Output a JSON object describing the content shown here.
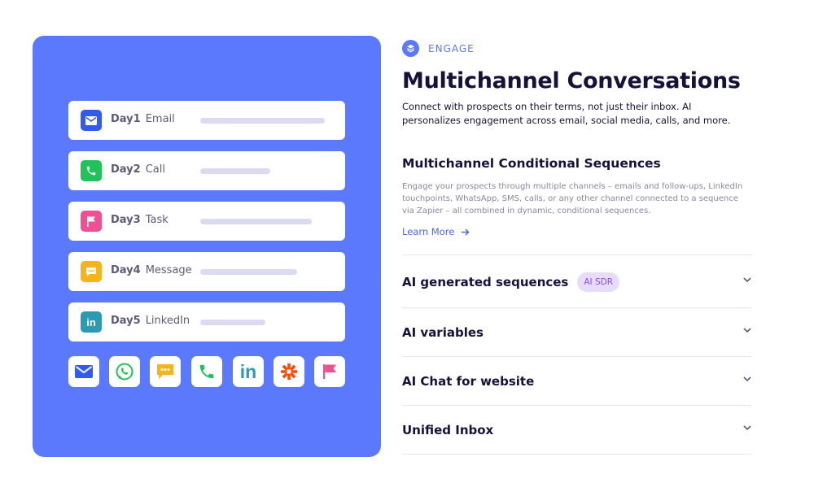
{
  "left": {
    "days": [
      {
        "day": "Day1",
        "channel": "Email",
        "icon": "email-icon",
        "color": "#2f5bf0",
        "bar_fraction": 0.9
      },
      {
        "day": "Day2",
        "channel": "Call",
        "icon": "phone-icon",
        "color": "#22c25a",
        "bar_fraction": 0.5
      },
      {
        "day": "Day3",
        "channel": "Task",
        "icon": "flag-icon",
        "color": "#f04f93",
        "bar_fraction": 0.8
      },
      {
        "day": "Day4",
        "channel": "Message",
        "icon": "message-icon",
        "color": "#f6b418",
        "bar_fraction": 0.7
      },
      {
        "day": "Day5",
        "channel": "LinkedIn",
        "icon": "linkedin-icon",
        "color": "#2a9bb0",
        "bar_fraction": 0.47
      }
    ],
    "channels": [
      "email-icon",
      "whatsapp-icon",
      "message-icon",
      "phone-icon",
      "linkedin-icon",
      "zapier-icon",
      "flag-icon"
    ],
    "panel_color": "#5a79fc"
  },
  "eyebrow": "ENGAGE",
  "title": "Multichannel Conversations",
  "subtitle": "Connect with prospects on their terms, not just their inbox. AI personalizes engagement across email, social media, calls, and more.",
  "section": {
    "title": "Multichannel Conditional Sequences",
    "description": "Engage your prospects through multiple channels – emails and follow-ups, LinkedIn touchpoints, WhatsApp, SMS, calls, or any other channel connected to a sequence via Zapier – all combined in dynamic, conditional sequences.",
    "link": "Learn More"
  },
  "accordion": [
    {
      "label": "AI generated sequences",
      "badge": "AI SDR"
    },
    {
      "label": "AI variables"
    },
    {
      "label": "AI Chat for website"
    },
    {
      "label": "Unified Inbox"
    }
  ]
}
